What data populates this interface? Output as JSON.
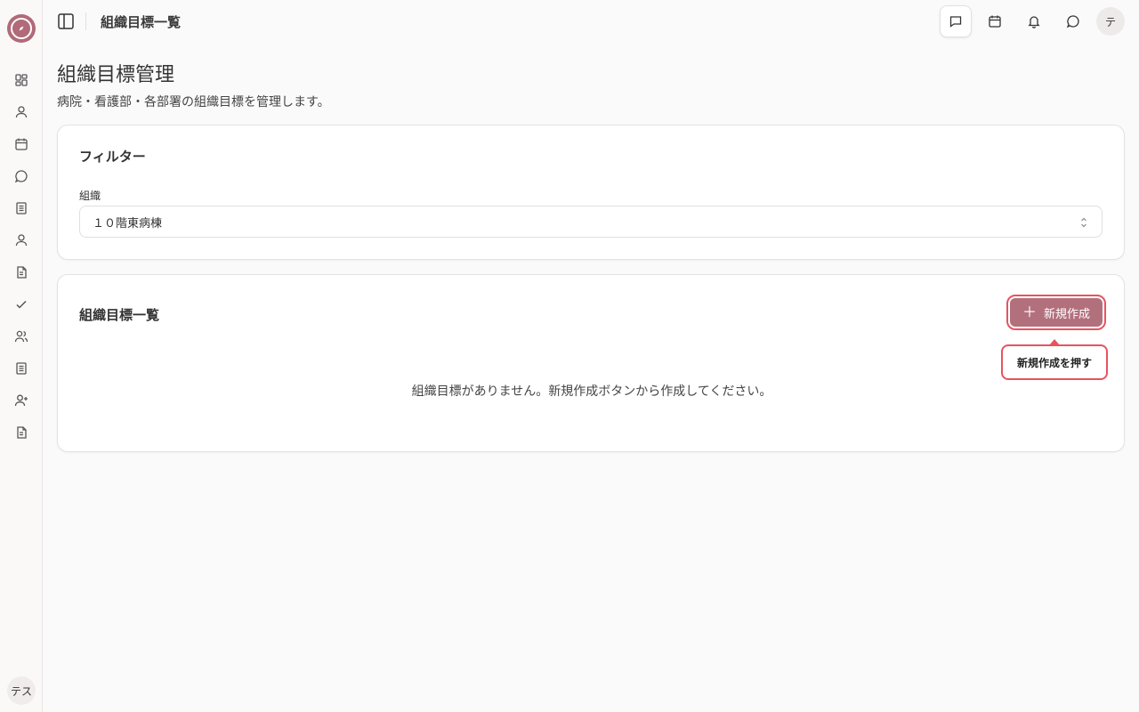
{
  "header": {
    "title": "組織目標一覧",
    "avatar": "テ"
  },
  "sidebar": {
    "user_chip": "テス",
    "items": [
      {
        "icon": "dashboard-icon"
      },
      {
        "icon": "user-icon"
      },
      {
        "icon": "calendar-icon"
      },
      {
        "icon": "chat-icon"
      },
      {
        "icon": "document-icon"
      },
      {
        "icon": "person-icon"
      },
      {
        "icon": "file-text-icon"
      },
      {
        "icon": "check-icon"
      },
      {
        "icon": "users-icon"
      },
      {
        "icon": "notebook-icon"
      },
      {
        "icon": "user-plus-icon"
      },
      {
        "icon": "report-icon"
      }
    ]
  },
  "page": {
    "title": "組織目標管理",
    "subtitle": "病院・看護部・各部署の組織目標を管理します。"
  },
  "filter": {
    "title": "フィルター",
    "org_label": "組織",
    "org_value": "１０階東病棟"
  },
  "list": {
    "title": "組織目標一覧",
    "create_label": "新規作成",
    "empty_message": "組織目標がありません。新規作成ボタンから作成してください。"
  },
  "tooltip": {
    "text": "新規作成を押す"
  },
  "colors": {
    "accent": "#b2707d",
    "highlight": "#e8535f"
  }
}
